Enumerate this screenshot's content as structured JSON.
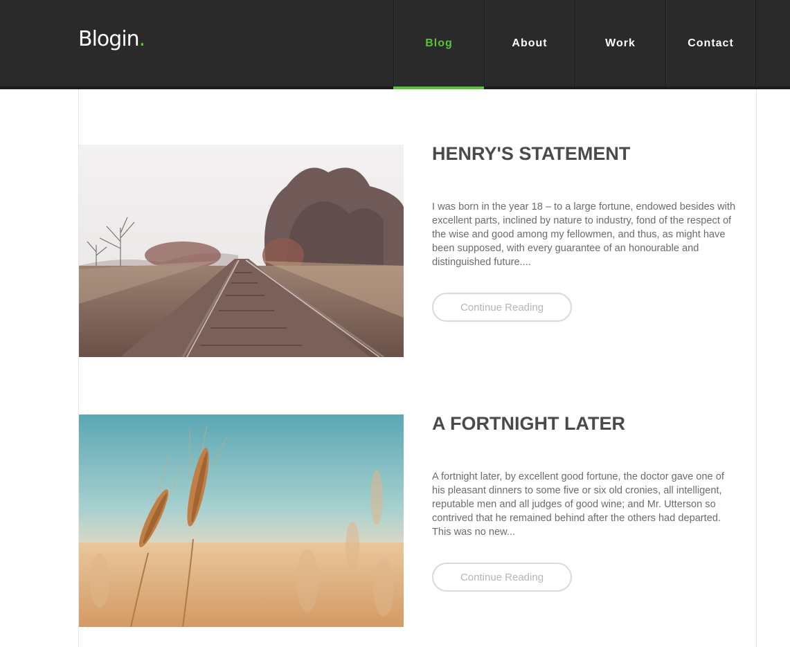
{
  "header": {
    "logo_text": "Blogin",
    "logo_dot": ".",
    "nav": [
      {
        "label": "Blog",
        "active": true
      },
      {
        "label": "About",
        "active": false
      },
      {
        "label": "Work",
        "active": false
      },
      {
        "label": "Contact",
        "active": false
      }
    ]
  },
  "colors": {
    "header_bg": "#2a2a2a",
    "accent": "#5bc236",
    "title": "#4a4a4a",
    "body_text": "#6b6b6b",
    "button_border": "#d9d9d9"
  },
  "posts": [
    {
      "image": "railroad-tracks-photo",
      "title": "HENRY'S STATEMENT",
      "excerpt": "I was born in the year 18 – to a large fortune, endowed besides with excellent parts, inclined by nature to industry, fond of the respect of the wise and good among my fellowmen, and thus, as might have been supposed, with every guarantee of an honourable and distinguished future....",
      "button_label": "Continue Reading"
    },
    {
      "image": "wheat-field-photo",
      "title": "A FORTNIGHT LATER",
      "excerpt": "A fortnight later, by excellent good fortune, the doctor gave one of his pleasant dinners to some five or six old cronies, all intelligent, reputable men and all judges of good wine; and Mr. Utterson so contrived that he remained behind after the others had departed. This was no new...",
      "button_label": "Continue Reading"
    }
  ]
}
